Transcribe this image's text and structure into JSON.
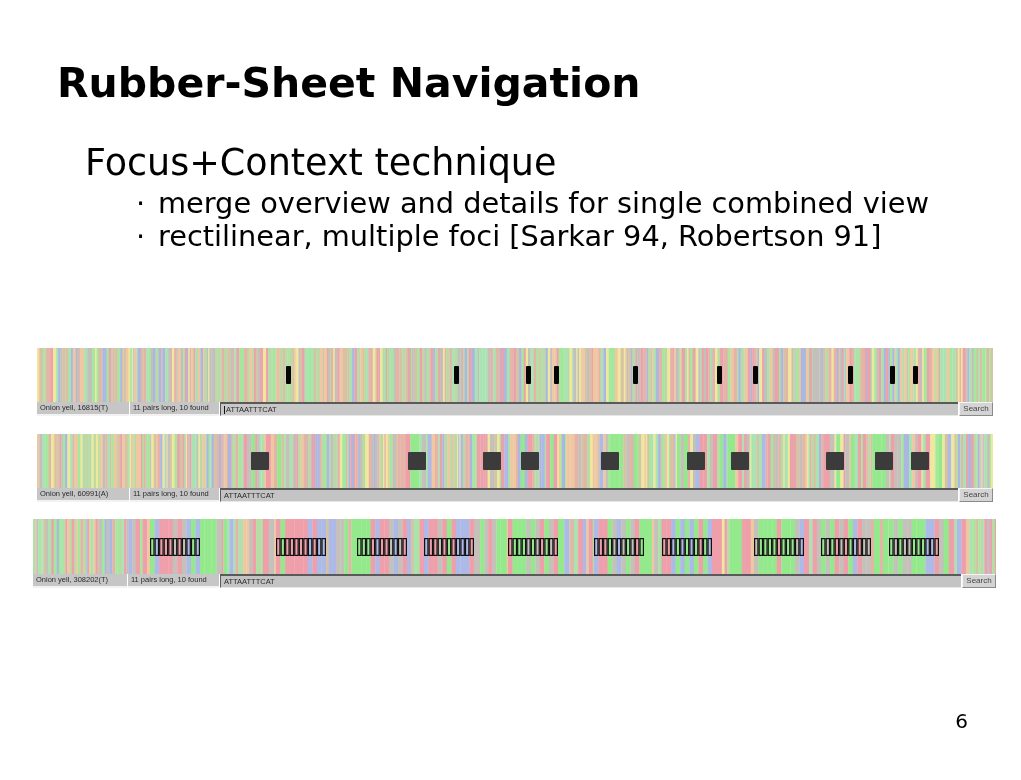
{
  "slide": {
    "title": "Rubber-Sheet Navigation",
    "subtitle": "Focus+Context technique",
    "bullets": [
      {
        "bullet": "·",
        "text": "merge overview and details for single combined view"
      },
      {
        "bullet": "·",
        "text": "rectilinear, multiple foci [Sarkar 94, Robertson 91]"
      }
    ],
    "page_number": "6"
  },
  "views": [
    {
      "kind": "bars",
      "position": "Onion yell, 16815(T)",
      "status": "11 pairs long, 10 found",
      "query": {
        "value": "ATTAATTTCAT",
        "focused": true
      },
      "button": "Search"
    },
    {
      "kind": "blocks",
      "position": "Onion yell, 60991(A)",
      "status": "11 pairs long, 10 found",
      "query": {
        "value": "ATTAATTTCAT",
        "focused": false
      },
      "button": "Search"
    },
    {
      "kind": "bases",
      "position": "Onion yell, 308202(T)",
      "status": "11 pairs long, 10 found",
      "query": {
        "value": "ATTAATTTCAT",
        "focused": false
      },
      "button": "Search"
    }
  ]
}
